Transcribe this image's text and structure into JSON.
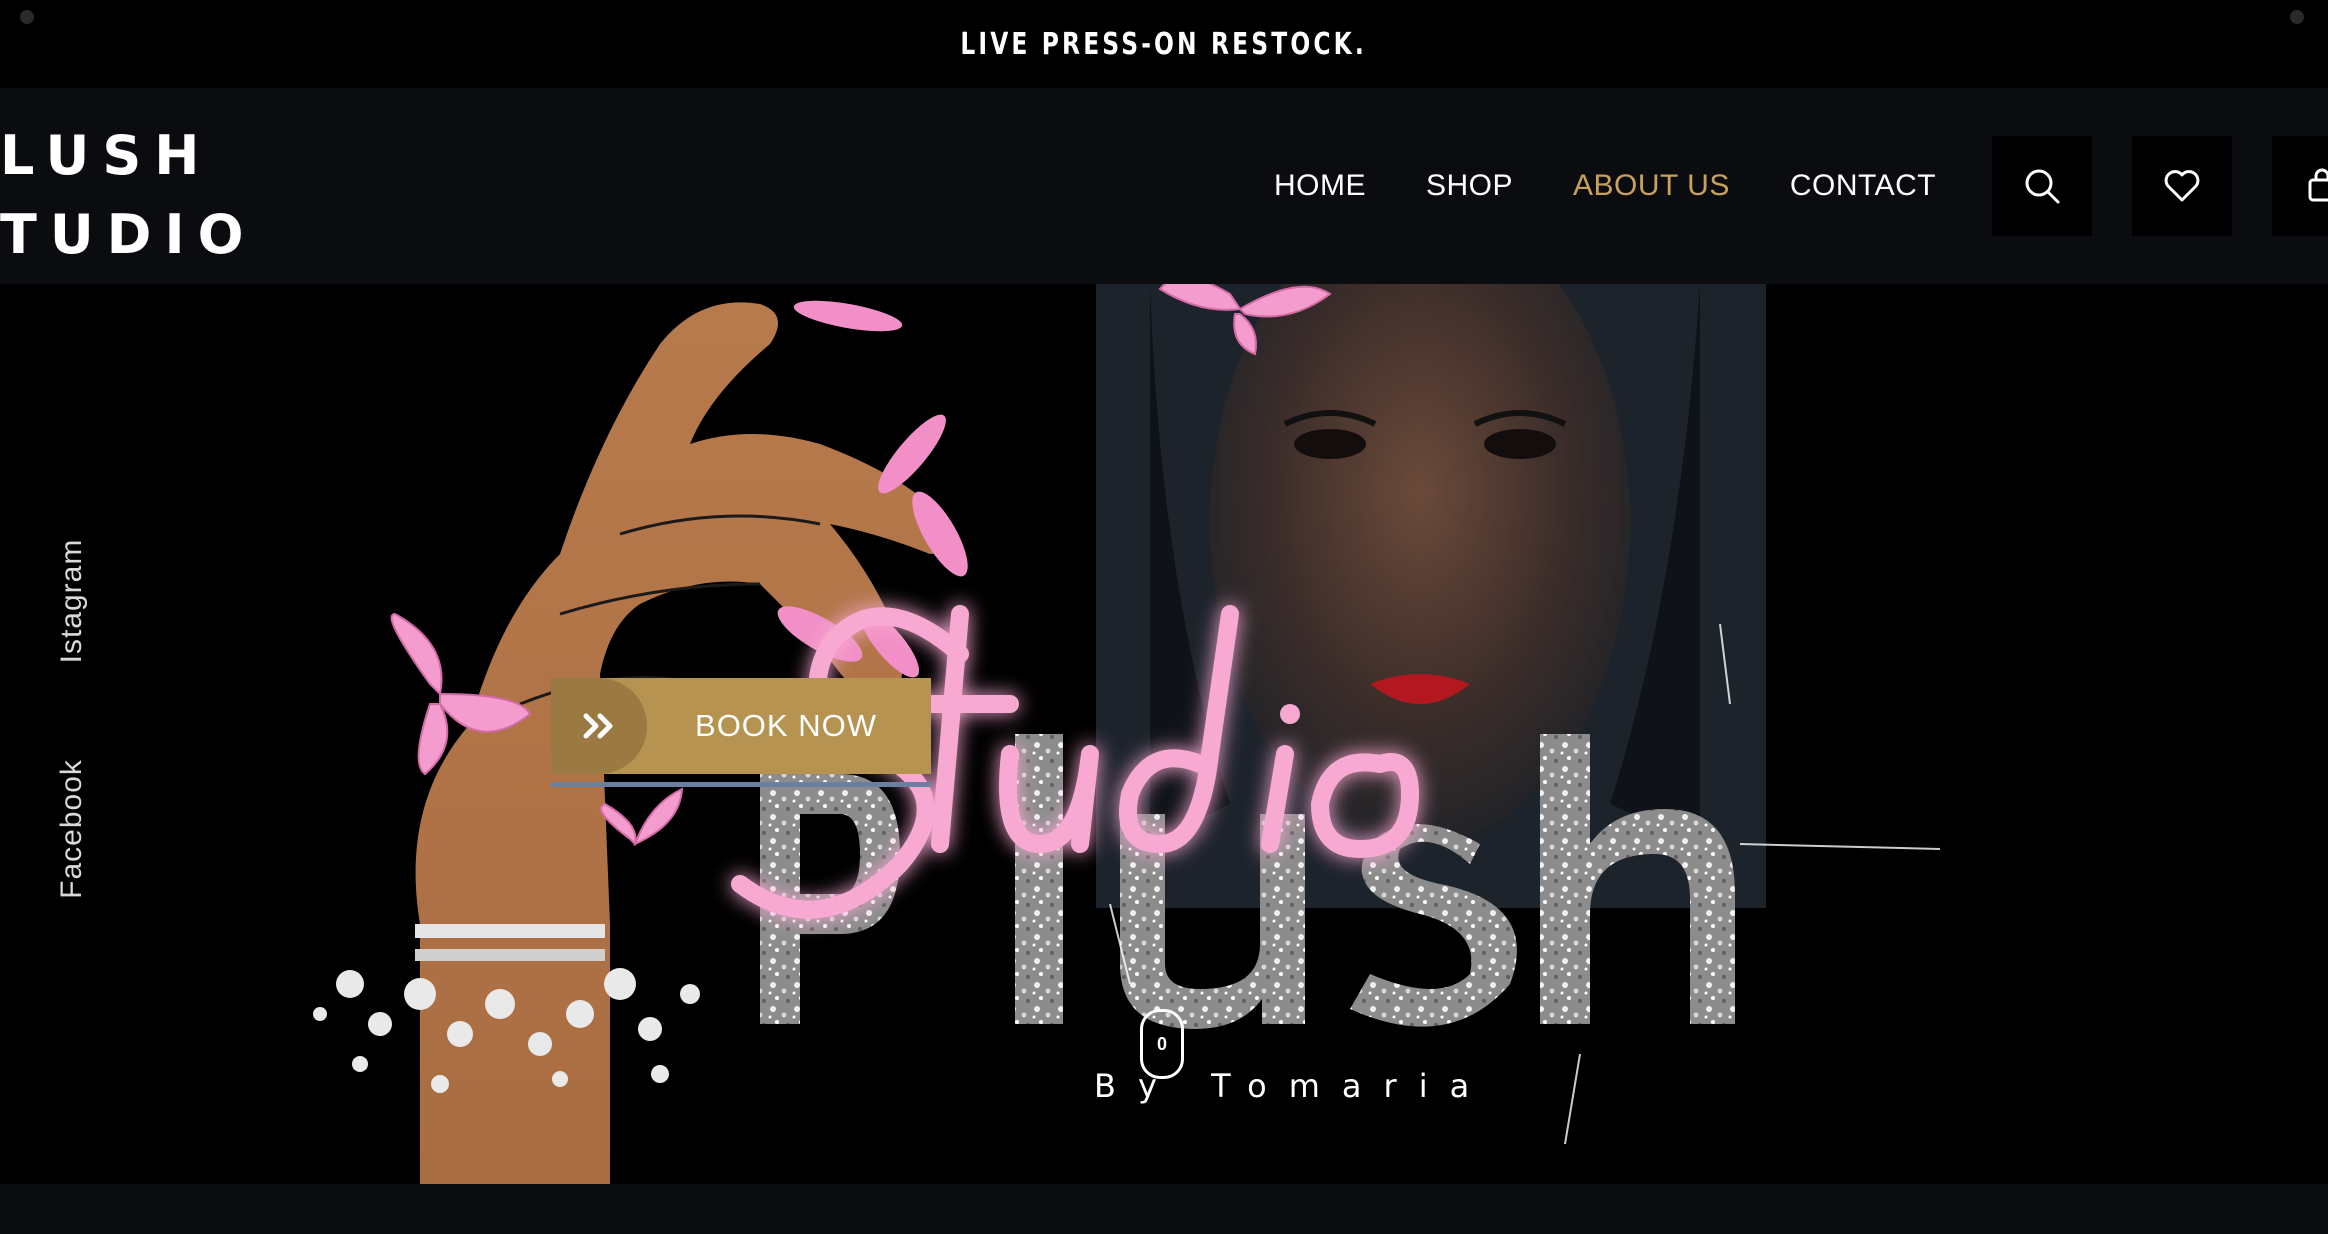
{
  "announcement": {
    "text": "LIVE PRESS-ON RESTOCK."
  },
  "header": {
    "logo_line1": "LUSH",
    "logo_line2": "TUDIO",
    "nav": {
      "home": "HOME",
      "shop": "SHOP",
      "about": "ABOUT US",
      "contact": "CONTACT"
    },
    "active_item": "ABOUT US",
    "icons": [
      "search-icon",
      "heart-icon",
      "cart-icon"
    ]
  },
  "social": {
    "instagram": "Istagram",
    "facebook": "Facebook"
  },
  "hero": {
    "book_button": "BOOK NOW",
    "script_text": "Studio",
    "brand_text": "Plush",
    "byline": "By Tomaria",
    "scroll_indicator": "0"
  },
  "colors": {
    "accent_gold": "#c9a15a",
    "button_gold": "#b79352",
    "pink": "#f4a8cf",
    "background": "#000000",
    "header_bg": "#0b0c0f"
  }
}
